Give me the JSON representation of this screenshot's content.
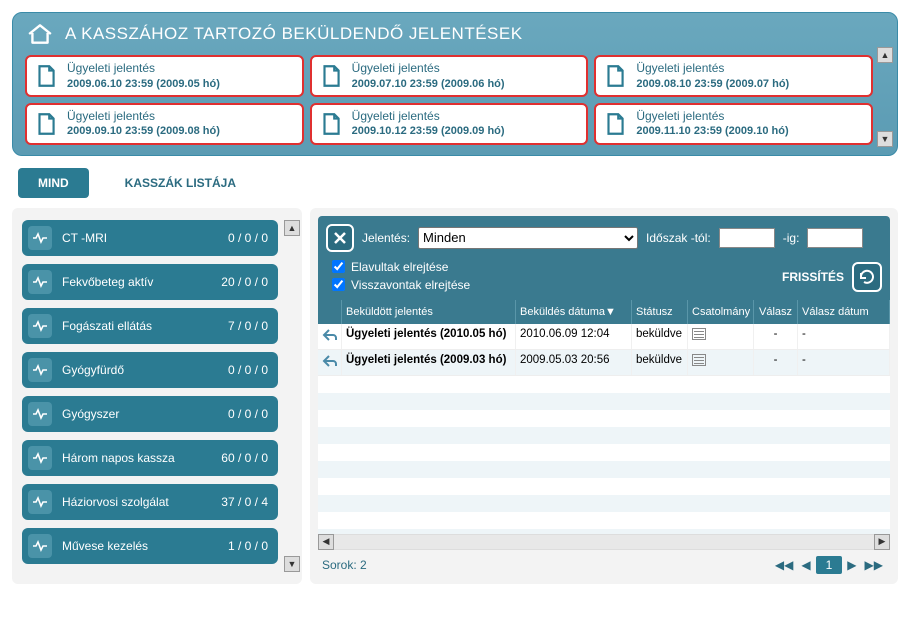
{
  "header": {
    "title": "A KASSZÁHOZ TARTOZÓ BEKÜLDENDŐ JELENTÉSEK"
  },
  "reports": [
    {
      "title": "Ügyeleti jelentés",
      "date": "2009.06.10 23:59 (2009.05 hó)"
    },
    {
      "title": "Ügyeleti jelentés",
      "date": "2009.07.10 23:59 (2009.06 hó)"
    },
    {
      "title": "Ügyeleti jelentés",
      "date": "2009.08.10 23:59 (2009.07 hó)"
    },
    {
      "title": "Ügyeleti jelentés",
      "date": "2009.09.10 23:59 (2009.08 hó)"
    },
    {
      "title": "Ügyeleti jelentés",
      "date": "2009.10.12 23:59 (2009.09 hó)"
    },
    {
      "title": "Ügyeleti jelentés",
      "date": "2009.11.10 23:59 (2009.10 hó)"
    }
  ],
  "tabs": {
    "mind": "MIND",
    "list": "KASSZÁK LISTÁJA"
  },
  "sidebar": [
    {
      "label": "CT -MRI",
      "count": "0 / 0 / 0"
    },
    {
      "label": "Fekvőbeteg aktív",
      "count": "20 / 0 / 0"
    },
    {
      "label": "Fogászati ellátás",
      "count": "7 / 0 / 0"
    },
    {
      "label": "Gyógyfürdő",
      "count": "0 / 0 / 0"
    },
    {
      "label": "Gyógyszer",
      "count": "0 / 0 / 0"
    },
    {
      "label": "Három napos kassza",
      "count": "60 / 0 / 0"
    },
    {
      "label": "Háziorvosi szolgálat",
      "count": "37 / 0 / 4"
    },
    {
      "label": "Művese kezelés",
      "count": "1 / 0 / 0"
    }
  ],
  "filter": {
    "label_jelentes": "Jelentés:",
    "select_value": "Minden",
    "label_from": "Időszak -tól:",
    "label_to": "-ig:",
    "chk_elavult": "Elavultak elrejtése",
    "chk_visszavont": "Visszavontak elrejtése",
    "refresh": "FRISSÍTÉS"
  },
  "table": {
    "headers": {
      "name": "Beküldött jelentés",
      "date": "Beküldés dátuma▼",
      "status": "Státusz",
      "attach": "Csatolmány",
      "reply": "Válasz",
      "rdate": "Válasz dátum"
    },
    "rows": [
      {
        "name": "Ügyeleti jelentés (2010.05 hó)",
        "date": "2010.06.09 12:04",
        "status": "beküldve",
        "reply": "-",
        "rdate": "-"
      },
      {
        "name": "Ügyeleti jelentés (2009.03 hó)",
        "date": "2009.05.03 20:56",
        "status": "beküldve",
        "reply": "-",
        "rdate": "-"
      }
    ]
  },
  "pager": {
    "rows_label": "Sorok: 2",
    "page": "1"
  }
}
